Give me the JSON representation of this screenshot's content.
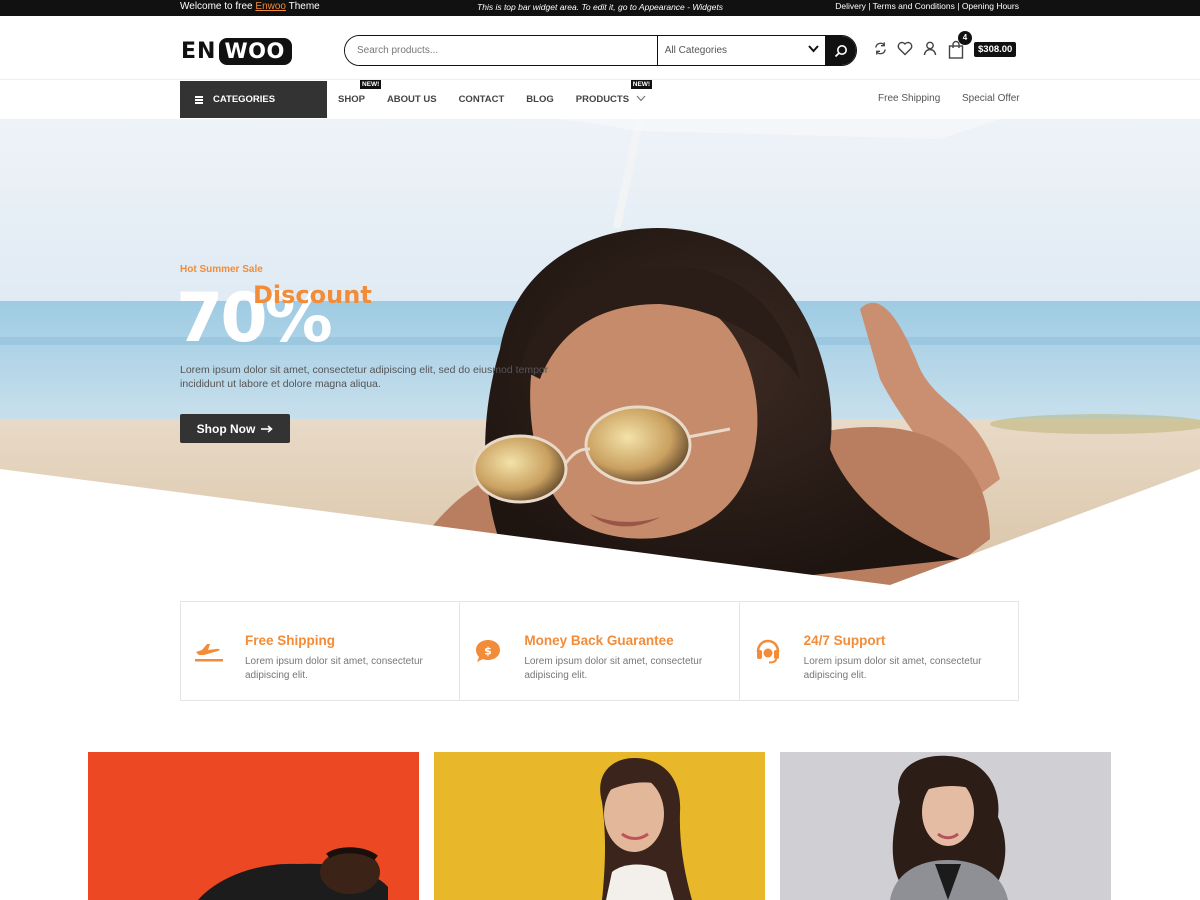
{
  "topbar": {
    "welcome_prefix": "Welcome to free",
    "welcome_link": "Enwoo",
    "welcome_suffix": "Theme",
    "widget_text": "This is top bar widget area. To edit it, go to Appearance - Widgets",
    "links": "Delivery | Terms and Conditions | Opening Hours"
  },
  "header": {
    "logo_en": "EN",
    "logo_woo": "WOO",
    "search_placeholder": "Search products...",
    "category_select": "All Categories",
    "cart_count": "4",
    "cart_total": "$308.00"
  },
  "nav": {
    "categories_label": "CATEGORIES",
    "items": [
      {
        "label": "SHOP",
        "badge": "NEW!"
      },
      {
        "label": "ABOUT US"
      },
      {
        "label": "CONTACT"
      },
      {
        "label": "BLOG"
      },
      {
        "label": "PRODUCTS",
        "badge": "NEW!"
      }
    ],
    "free_shipping": "Free Shipping",
    "special_offer": "Special Offer"
  },
  "hero": {
    "tag": "Hot Summer Sale",
    "percent": "70%",
    "discount": "Discount",
    "description": "Lorem ipsum dolor sit amet, consectetur adipiscing elit, sed do eiusmod tempor incididunt ut labore et dolore magna aliqua.",
    "button": "Shop Now"
  },
  "features": [
    {
      "icon": "plane-icon",
      "title": "Free Shipping",
      "text": "Lorem ipsum dolor sit amet, consectetur adipiscing elit."
    },
    {
      "icon": "money-icon",
      "title": "Money Back Guarantee",
      "text": "Lorem ipsum dolor sit amet, consectetur adipiscing elit."
    },
    {
      "icon": "headset-icon",
      "title": "24/7 Support",
      "text": "Lorem ipsum dolor sit amet, consectetur adipiscing elit."
    }
  ],
  "colors": {
    "accent": "#f28c38",
    "dark": "#111111",
    "banner_red": "#e8401f",
    "banner_yellow": "#e9b82a",
    "banner_grey": "#cfcfd4"
  }
}
